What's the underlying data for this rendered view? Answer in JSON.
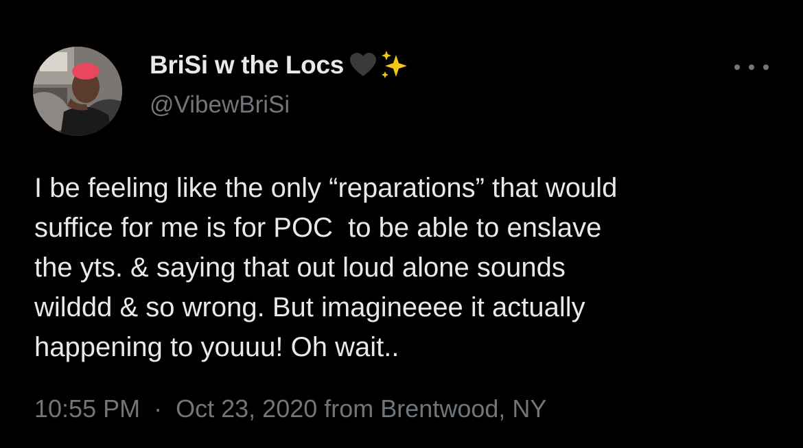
{
  "user": {
    "display_name": "BriSi w the Locs",
    "name_emojis": [
      "black-heart-icon",
      "sparkles-icon"
    ],
    "handle": "@VibewBriSi",
    "avatar": "profile-photo"
  },
  "more_button": {
    "icon": "more-dots-icon"
  },
  "tweet": {
    "lines": [
      "I be feeling like the only “reparations” that would",
      "suffice for me is for POC  to be able to enslave",
      "the yts. & saying that out loud alone sounds",
      "wilddd & so wrong. But imagineeee it actually",
      "happening to youuu! Oh wait.."
    ]
  },
  "meta": {
    "time": "10:55 PM",
    "separator": "·",
    "date": "Oct 23, 2020",
    "source": "from Brentwood, NY"
  },
  "colors": {
    "background": "#000000",
    "primary_text": "#e7e9ea",
    "secondary_text": "#71767b",
    "avatar_hair": "#e8475f",
    "sparkle": "#f5c518"
  }
}
